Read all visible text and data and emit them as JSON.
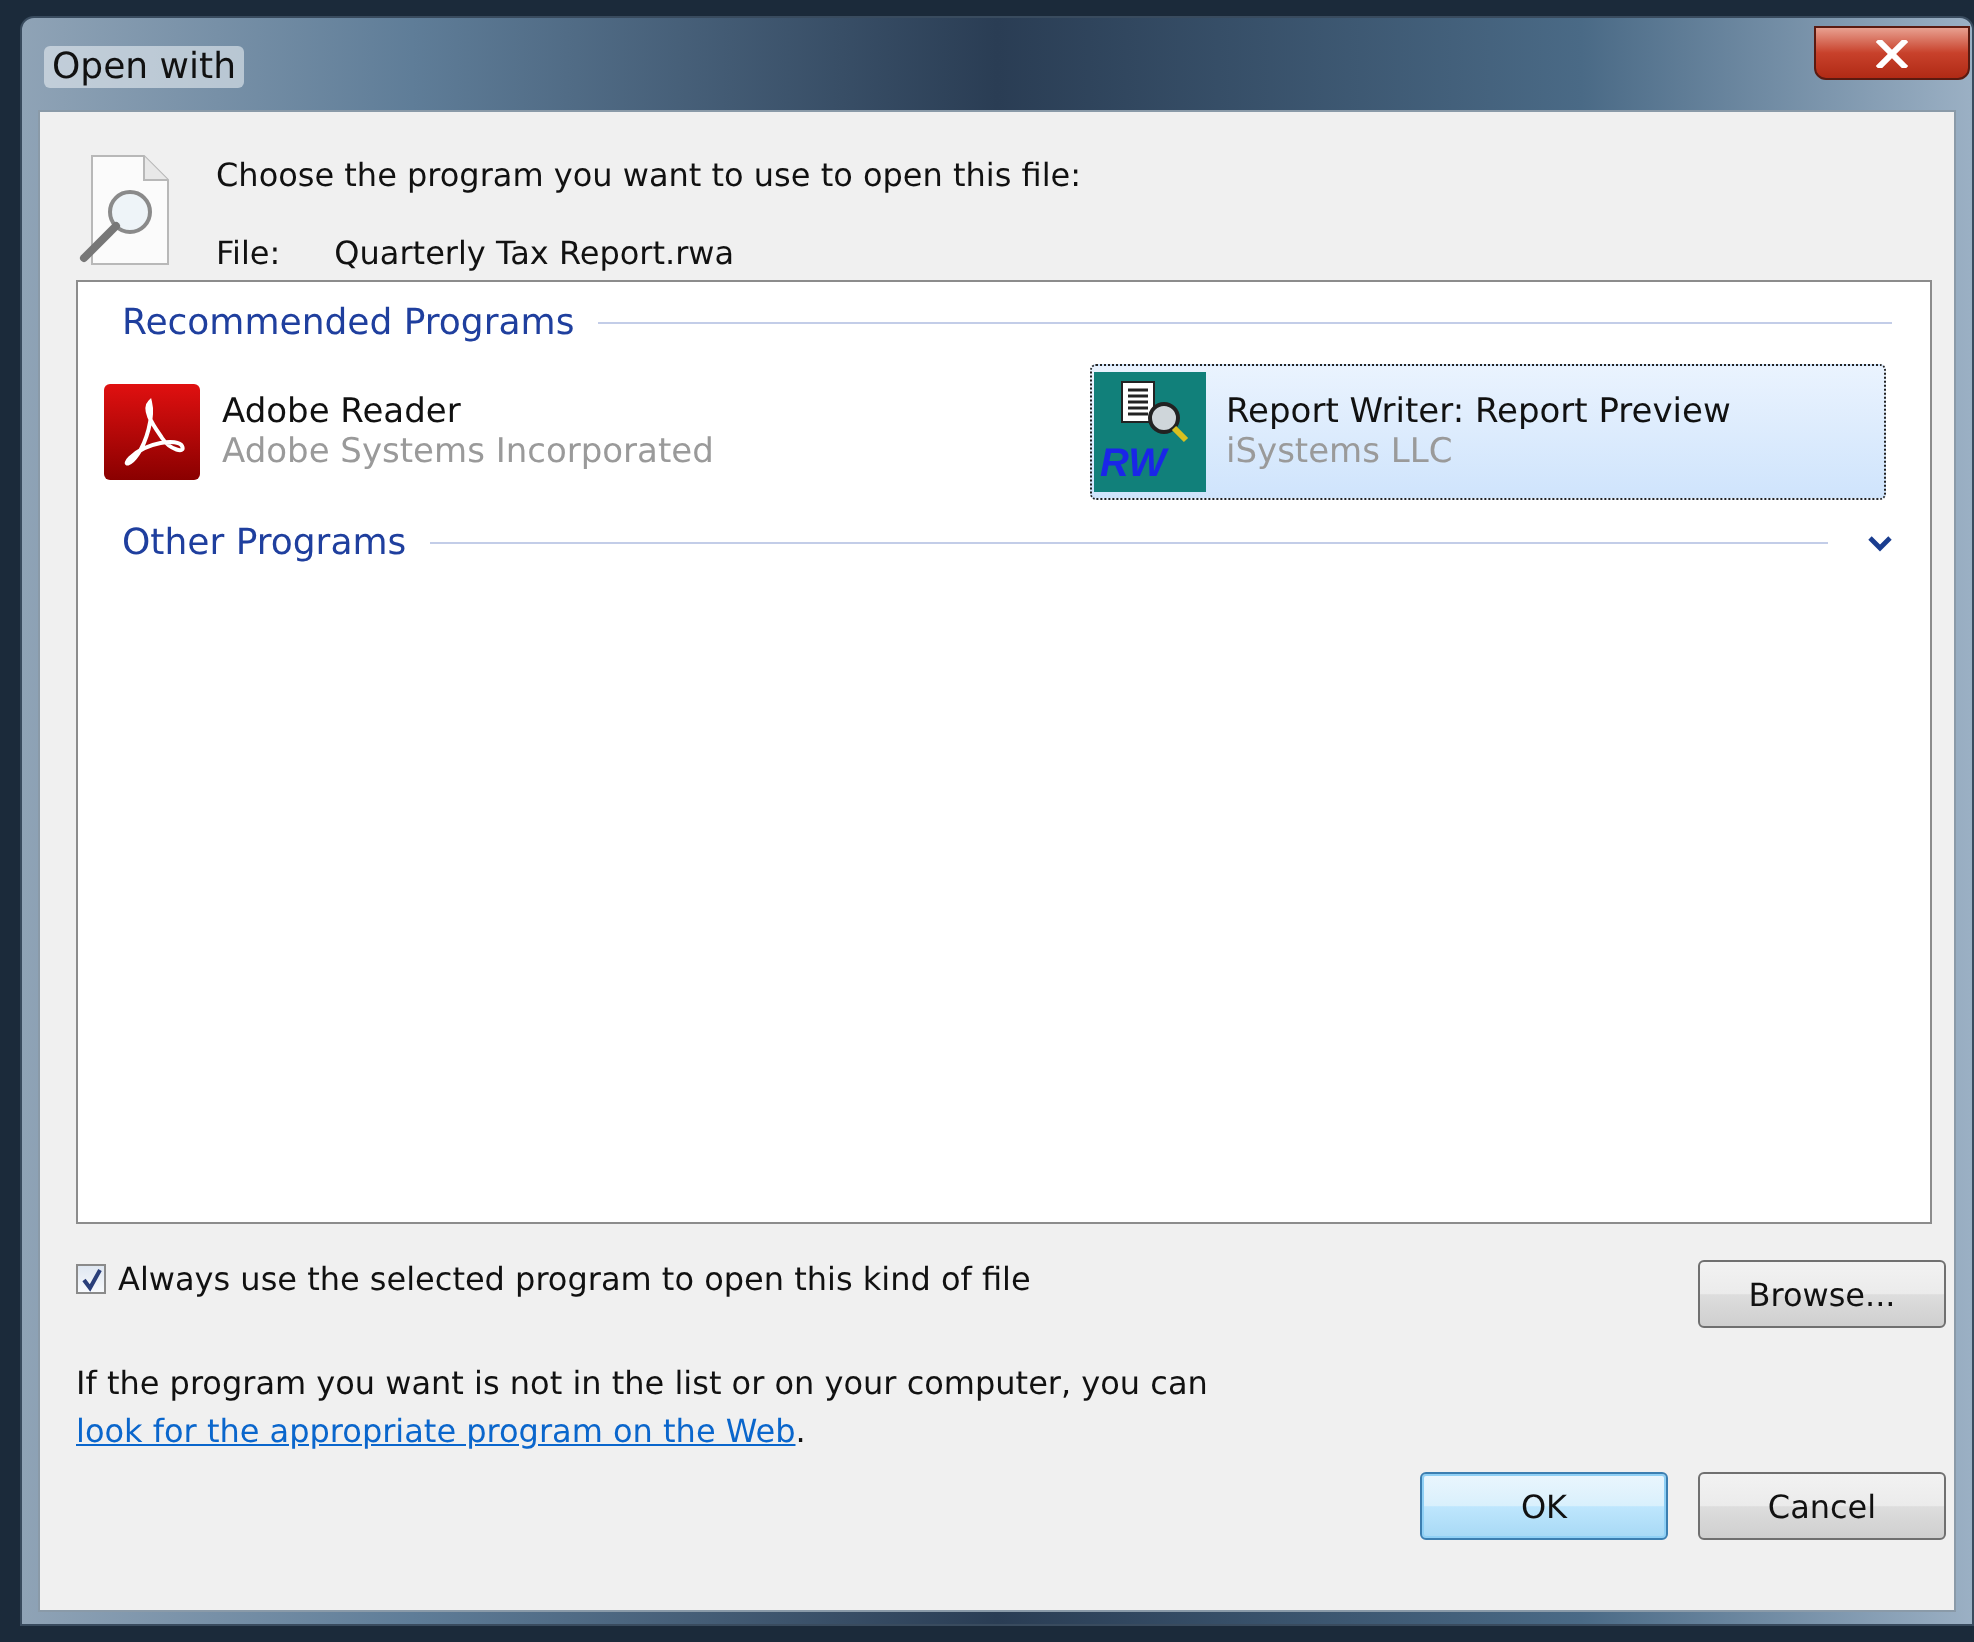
{
  "window": {
    "title": "Open with"
  },
  "header": {
    "prompt": "Choose the program you want to use to open this file:",
    "file_label": "File:",
    "file_name": "Quarterly Tax Report.rwa"
  },
  "program_groups": [
    {
      "title": "Recommended Programs",
      "collapsed": false,
      "programs": [
        {
          "name": "Adobe Reader",
          "publisher": "Adobe Systems Incorporated",
          "kind": "pdf",
          "selected": false
        },
        {
          "name": "Report Writer: Report Preview",
          "publisher": "iSystems LLC",
          "kind": "rw",
          "icon_label": "RW",
          "selected": true
        }
      ]
    },
    {
      "title": "Other Programs",
      "collapsed": true
    }
  ],
  "always_use": {
    "label": "Always use the selected program to open this kind of file",
    "checked": true
  },
  "browse_button": "Browse...",
  "help": {
    "text": "If the program you want is not in the list or on your computer, you can ",
    "link": "look for the appropriate program on the Web",
    "text_after": "."
  },
  "buttons": [
    {
      "label": "OK",
      "default": true
    },
    {
      "label": "Cancel",
      "default": false
    }
  ]
}
